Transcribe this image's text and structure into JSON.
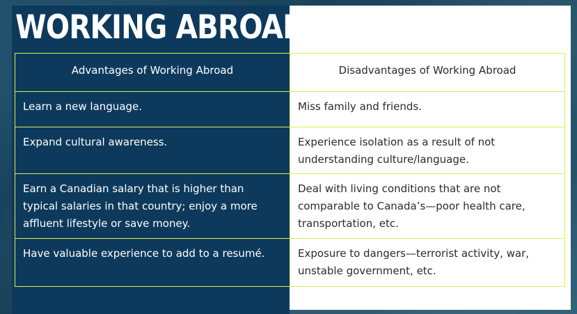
{
  "title": "WORKING ABROAD",
  "table": {
    "headers": [
      "Advantages of Working Abroad",
      "Disadvantages of Working Abroad"
    ],
    "rows": [
      [
        "Learn a new language.",
        "Miss family and friends."
      ],
      [
        "Expand cultural awareness.",
        "Experience isolation as a result of not understanding culture/language."
      ],
      [
        "Earn a Canadian salary that is higher than typical salaries in that country; enjoy a more affluent lifestyle or save money.",
        "Deal with living conditions that are not comparable to Canada’s—poor health care, transportation, etc."
      ],
      [
        "Have valuable experience to add to a resumé.",
        "Exposure to dangers—terrorist activity, war, unstable government, etc."
      ]
    ]
  },
  "colors": {
    "panel_navy": "#0d3a5c",
    "border_yellow": "#e3ee50",
    "right_panel": "#ffffff"
  }
}
